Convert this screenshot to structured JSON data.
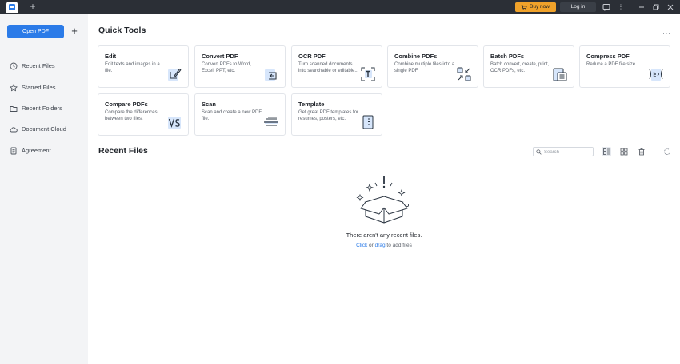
{
  "titlebar": {
    "buy_label": "Buy now",
    "login_label": "Log in",
    "accent": "#f0a22a"
  },
  "sidebar": {
    "open_pdf_label": "Open PDF",
    "items": [
      {
        "label": "Recent Files",
        "icon": "clock-icon"
      },
      {
        "label": "Starred Files",
        "icon": "star-icon"
      },
      {
        "label": "Recent Folders",
        "icon": "folder-icon"
      },
      {
        "label": "Document Cloud",
        "icon": "cloud-icon"
      },
      {
        "label": "Agreement",
        "icon": "document-icon"
      }
    ]
  },
  "quick_tools": {
    "title": "Quick Tools",
    "cards": [
      {
        "title": "Edit",
        "desc": "Edit texts and images in a file.",
        "icon": "edit-icon"
      },
      {
        "title": "Convert PDF",
        "desc": "Convert PDFs to Word, Excel, PPT, etc.",
        "icon": "convert-icon"
      },
      {
        "title": "OCR PDF",
        "desc": "Turn scanned documents into searchable or editable...",
        "icon": "ocr-icon"
      },
      {
        "title": "Combine PDFs",
        "desc": "Combine multiple files into a single PDF.",
        "icon": "combine-icon"
      },
      {
        "title": "Batch PDFs",
        "desc": "Batch convert, create, print, OCR PDFs, etc.",
        "icon": "batch-icon"
      },
      {
        "title": "Compress PDF",
        "desc": "Reduce a PDF file size.",
        "icon": "compress-icon"
      },
      {
        "title": "Compare PDFs",
        "desc": "Compare the differences between two files.",
        "icon": "compare-icon"
      },
      {
        "title": "Scan",
        "desc": "Scan and create a new PDF file.",
        "icon": "scan-icon"
      },
      {
        "title": "Template",
        "desc": "Get great PDF templates for resumes, posters, etc.",
        "icon": "template-icon"
      }
    ]
  },
  "recent_files": {
    "title": "Recent Files",
    "search_placeholder": "Search",
    "empty_message": "There aren't any recent files.",
    "hint_click": "Click",
    "hint_or": " or ",
    "hint_drag": "drag",
    "hint_rest": " to add files"
  }
}
